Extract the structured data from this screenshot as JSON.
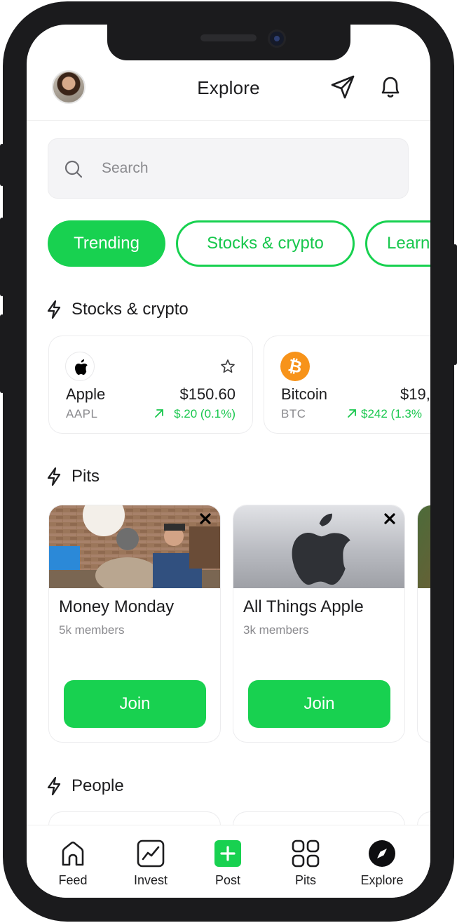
{
  "header": {
    "title": "Explore"
  },
  "search": {
    "placeholder": "Search"
  },
  "chips": [
    {
      "label": "Trending",
      "active": true
    },
    {
      "label": "Stocks & crypto",
      "active": false
    },
    {
      "label": "Learn",
      "active": false
    }
  ],
  "sections": {
    "stocks": "Stocks & crypto",
    "pits": "Pits",
    "people": "People"
  },
  "stocks": [
    {
      "name": "Apple",
      "symbol": "AAPL",
      "price": "$150.60",
      "change": "$.20 (0.1%)",
      "icon": "apple-logo-icon"
    },
    {
      "name": "Bitcoin",
      "symbol": "BTC",
      "price": "$19,",
      "change": "$242 (1.3%",
      "icon": "bitcoin-logo-icon"
    }
  ],
  "pits": [
    {
      "name": "Money Monday",
      "members": "5k members",
      "button": "Join",
      "image": "podcast-studio-photo"
    },
    {
      "name": "All Things Apple",
      "members": "3k members",
      "button": "Join",
      "image": "apple-logo-photo"
    }
  ],
  "tabbar": [
    {
      "label": "Feed",
      "icon": "home-icon"
    },
    {
      "label": "Invest",
      "icon": "chart-icon"
    },
    {
      "label": "Post",
      "icon": "plus-icon"
    },
    {
      "label": "Pits",
      "icon": "grid-icon"
    },
    {
      "label": "Explore",
      "icon": "compass-icon"
    }
  ],
  "colors": {
    "accent": "#18d150",
    "positive": "#18c74d",
    "bitcoin": "#f7931a"
  }
}
